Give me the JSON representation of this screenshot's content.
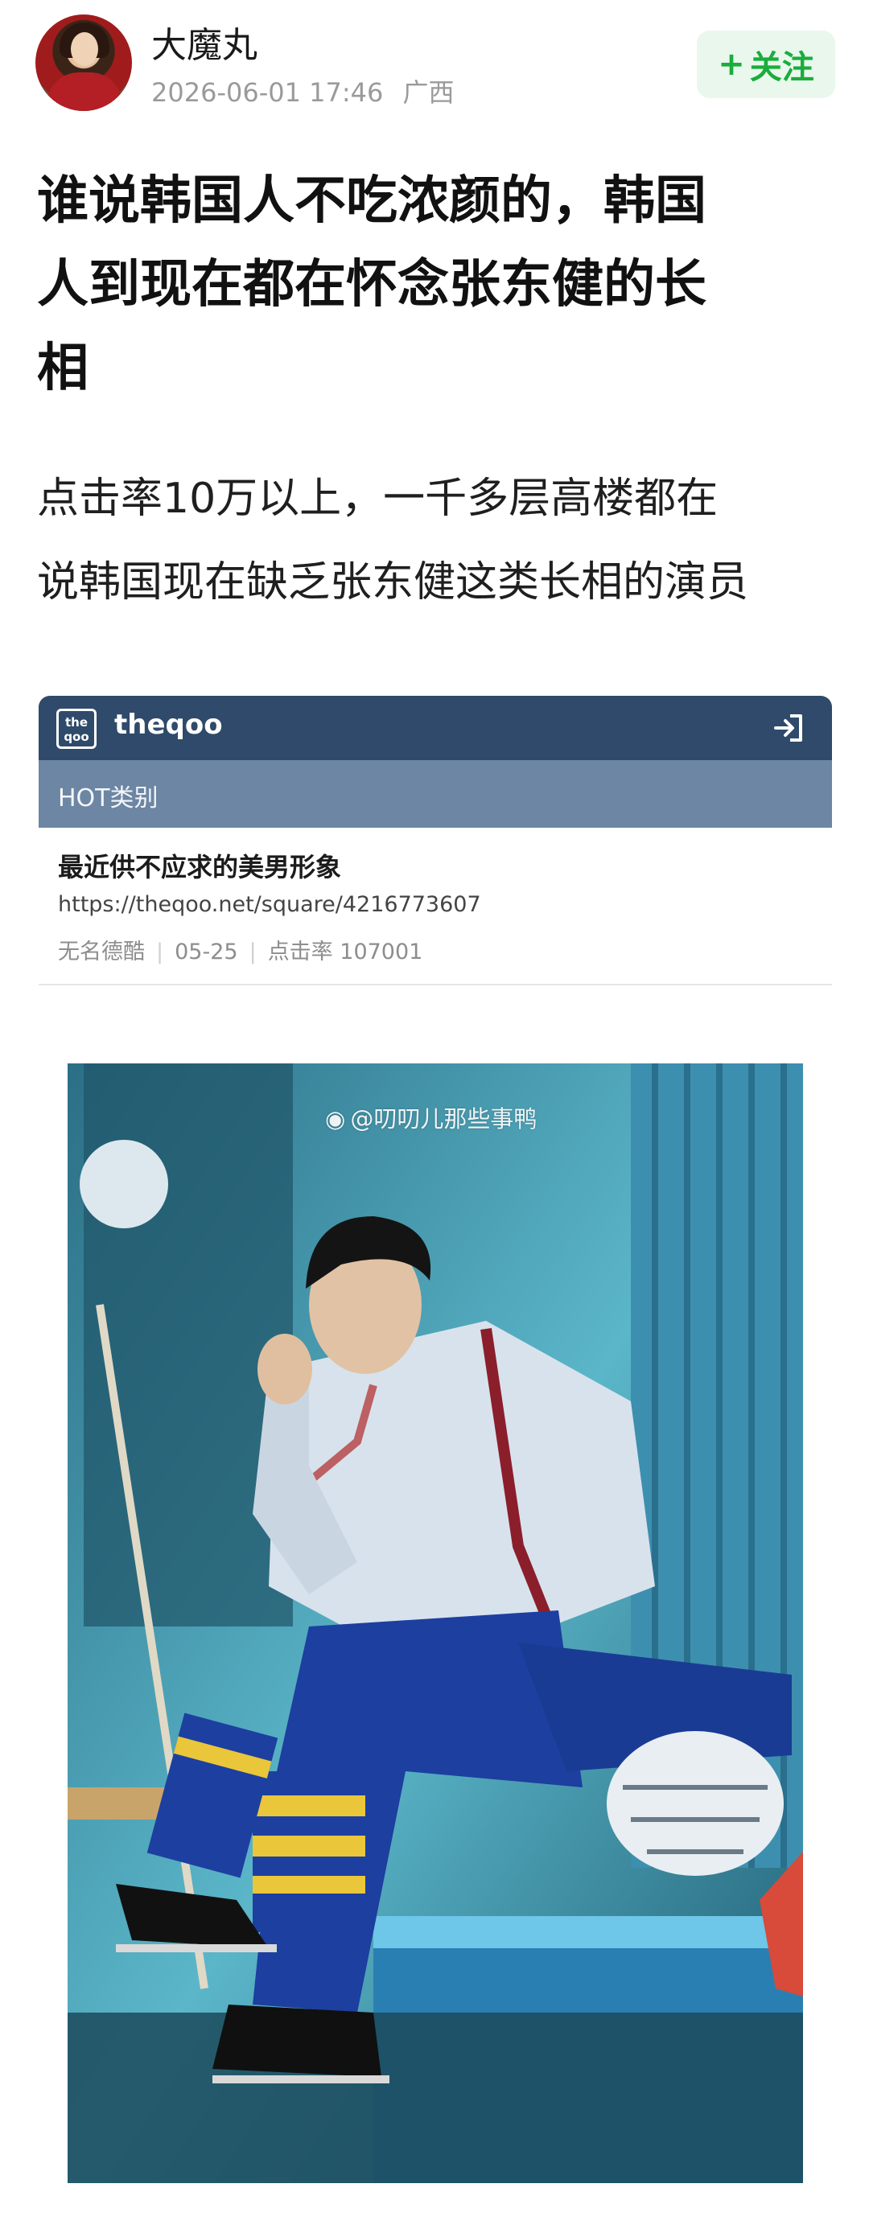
{
  "header": {
    "username": "大魔丸",
    "date": "2026-06-01 17:46",
    "location": "广西",
    "follow_label": "关注",
    "follow_plus": "+"
  },
  "title_lines": [
    "谁说韩国人不吃浓颜的，韩国",
    "人到现在都在怀念张东健的长",
    "相"
  ],
  "body_lines": [
    "点击率10万以上，一千多层高楼都在",
    "说韩国现在缺乏张东健这类长相的演员"
  ],
  "card": {
    "logo_line1": "the",
    "logo_line2": "qoo",
    "brand": "theqoo",
    "category": "HOT类别",
    "post_title": "最近供不应求的美男形象",
    "post_url": "https://theqoo.net/square/4216773607",
    "author": "无名德酷",
    "date": "05-25",
    "views": "点击率 107001",
    "login_icon": "login-arrow-icon"
  },
  "photo": {
    "watermark": "@叨叨儿那些事鸭",
    "watermark_icon": "weibo-icon"
  },
  "colors": {
    "follow_green": "#1aad3d",
    "follow_bg": "#e9f7ec",
    "card_header": "#2f4a6a",
    "card_sub": "#6c86a3"
  }
}
